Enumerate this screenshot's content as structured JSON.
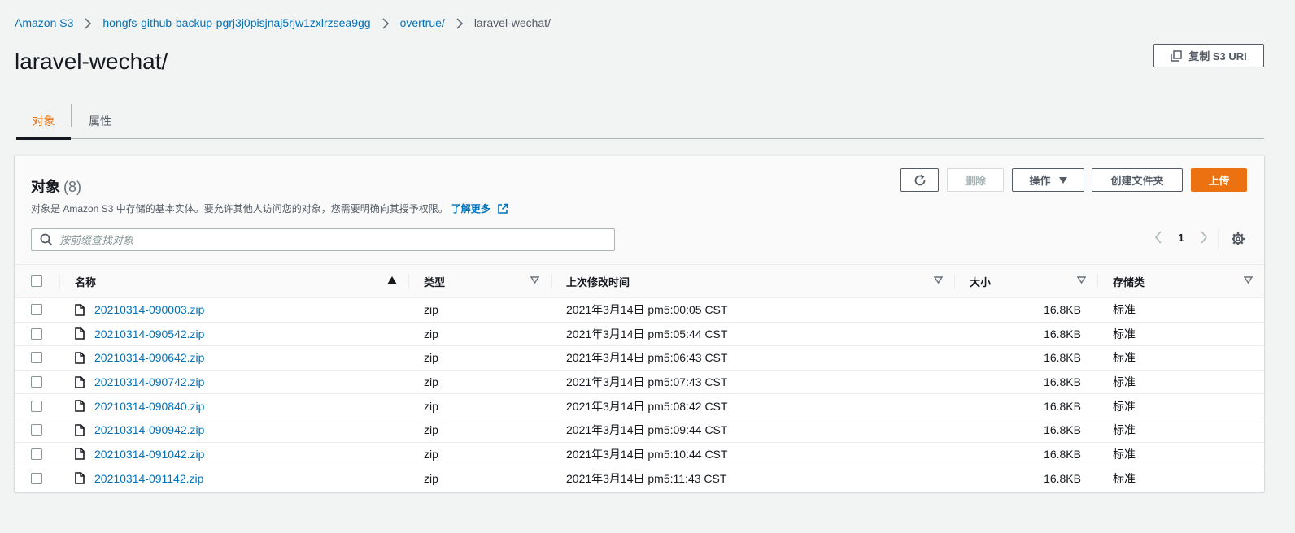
{
  "breadcrumb": {
    "items": [
      "Amazon S3",
      "hongfs-github-backup-pgrj3j0pisjnaj5rjw1zxlrzsea9gg",
      "overtrue/"
    ],
    "current": "laravel-wechat/"
  },
  "page_title": "laravel-wechat/",
  "copy_uri_label": "复制 S3 URI",
  "tabs": [
    {
      "label": "对象",
      "active": true
    },
    {
      "label": "属性",
      "active": false
    }
  ],
  "objects_panel": {
    "title": "对象",
    "count": "(8)",
    "description": "对象是 Amazon S3 中存储的基本实体。要允许其他人访问您的对象，您需要明确向其授予权限。",
    "learn_more": "了解更多",
    "buttons": {
      "delete": "删除",
      "actions": "操作",
      "create_folder": "创建文件夹",
      "upload": "上传"
    },
    "search_placeholder": "按前缀查找对象",
    "page": "1"
  },
  "table": {
    "headers": {
      "name": "名称",
      "type": "类型",
      "modified": "上次修改时间",
      "size": "大小",
      "storage_class": "存储类"
    },
    "rows": [
      {
        "name": "20210314-090003.zip",
        "type": "zip",
        "modified": "2021年3月14日 pm5:00:05 CST",
        "size": "16.8KB",
        "storage_class": "标准"
      },
      {
        "name": "20210314-090542.zip",
        "type": "zip",
        "modified": "2021年3月14日 pm5:05:44 CST",
        "size": "16.8KB",
        "storage_class": "标准"
      },
      {
        "name": "20210314-090642.zip",
        "type": "zip",
        "modified": "2021年3月14日 pm5:06:43 CST",
        "size": "16.8KB",
        "storage_class": "标准"
      },
      {
        "name": "20210314-090742.zip",
        "type": "zip",
        "modified": "2021年3月14日 pm5:07:43 CST",
        "size": "16.8KB",
        "storage_class": "标准"
      },
      {
        "name": "20210314-090840.zip",
        "type": "zip",
        "modified": "2021年3月14日 pm5:08:42 CST",
        "size": "16.8KB",
        "storage_class": "标准"
      },
      {
        "name": "20210314-090942.zip",
        "type": "zip",
        "modified": "2021年3月14日 pm5:09:44 CST",
        "size": "16.8KB",
        "storage_class": "标准"
      },
      {
        "name": "20210314-091042.zip",
        "type": "zip",
        "modified": "2021年3月14日 pm5:10:44 CST",
        "size": "16.8KB",
        "storage_class": "标准"
      },
      {
        "name": "20210314-091142.zip",
        "type": "zip",
        "modified": "2021年3月14日 pm5:11:43 CST",
        "size": "16.8KB",
        "storage_class": "标准"
      }
    ]
  },
  "colors": {
    "accent": "#ec7211",
    "link": "#0073bb",
    "text": "#16191f",
    "background": "#f2f3f3"
  }
}
